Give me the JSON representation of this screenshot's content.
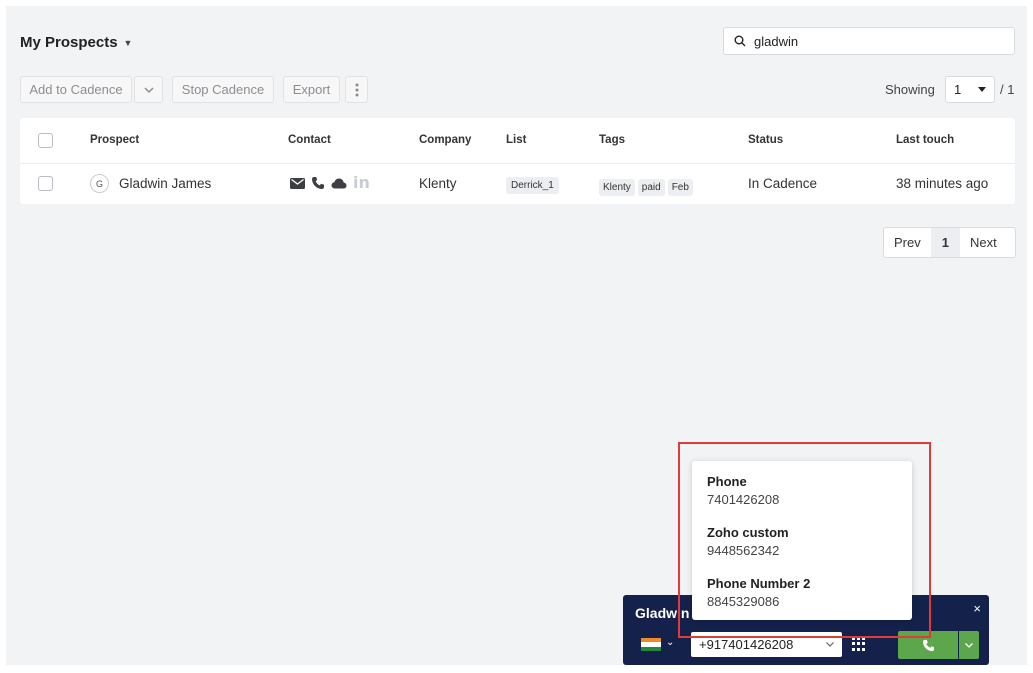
{
  "header": {
    "title": "My Prospects",
    "search_value": "gladwin"
  },
  "toolbar": {
    "add_to_cadence": "Add to Cadence",
    "stop_cadence": "Stop Cadence",
    "export": "Export",
    "showing_label": "Showing",
    "page_selected": "1",
    "page_total": "/ 1"
  },
  "table": {
    "columns": [
      "Prospect",
      "Contact",
      "Company",
      "List",
      "Tags",
      "Status",
      "Last touch"
    ],
    "rows": [
      {
        "avatar_initial": "G",
        "prospect": "Gladwin James",
        "company": "Klenty",
        "list": "Derrick_1",
        "tags": [
          "Klenty",
          "paid",
          "Feb"
        ],
        "status": "In Cadence",
        "last_touch": "38 minutes ago"
      }
    ]
  },
  "pagination": {
    "prev": "Prev",
    "current": "1",
    "next": "Next"
  },
  "dialer": {
    "name": "Gladwin",
    "phone_value": "+917401426208",
    "close": "×",
    "call_color": "#5ca64c",
    "bg_color": "#14214b"
  },
  "numbers_popup": {
    "items": [
      {
        "label": "Phone",
        "value": "7401426208"
      },
      {
        "label": "Zoho custom",
        "value": "9448562342"
      },
      {
        "label": "Phone Number 2",
        "value": "8845329086"
      }
    ]
  },
  "colors": {
    "highlight": "#e03b3b"
  }
}
